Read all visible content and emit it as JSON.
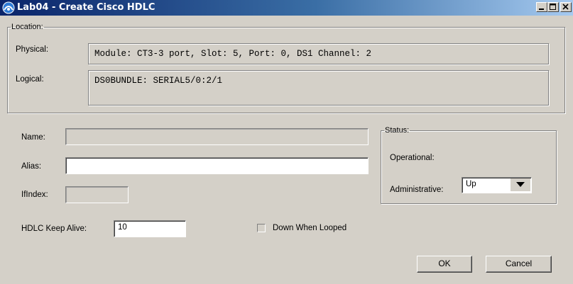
{
  "window": {
    "title": "Lab04 - Create Cisco HDLC",
    "icon": "cisco-app-icon"
  },
  "location": {
    "legend": "Location:",
    "physical_label": "Physical:",
    "physical_value": "Module: CT3-3 port, Slot: 5, Port: 0, DS1 Channel: 2",
    "logical_label": "Logical:",
    "logical_value": "DS0BUNDLE: SERIAL5/0:2/1"
  },
  "form": {
    "name_label": "Name:",
    "name_value": "",
    "alias_label": "Alias:",
    "alias_value": "",
    "ifindex_label": "IfIndex:",
    "ifindex_value": "",
    "keepalive_label": "HDLC Keep Alive:",
    "keepalive_value": "10",
    "down_when_looped_label": "Down When Looped",
    "down_when_looped_checked": false
  },
  "status": {
    "legend": "Status:",
    "operational_label": "Operational:",
    "operational_value": "",
    "administrative_label": "Administrative:",
    "administrative_value": "Up"
  },
  "buttons": {
    "ok": "OK",
    "cancel": "Cancel"
  },
  "colors": {
    "titlebar_start": "#0a246a",
    "titlebar_end": "#a6caf0",
    "dialog_background": "#d4d0c8"
  }
}
